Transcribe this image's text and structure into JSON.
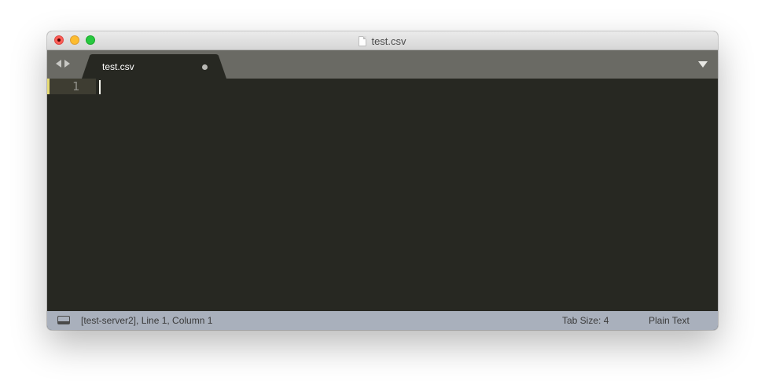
{
  "window": {
    "title": "test.csv"
  },
  "tabs": [
    {
      "label": "test.csv",
      "dirty": true
    }
  ],
  "editor": {
    "line_numbers": [
      "1"
    ]
  },
  "status_bar": {
    "location": "[test-server2], Line 1, Column 1",
    "tab_size": "Tab Size: 4",
    "syntax": "Plain Text"
  },
  "icons": {
    "file": "file-icon",
    "panel": "panel-toggle-icon"
  },
  "colors": {
    "editor_background": "#272822",
    "tabbar_background": "#6a6a64",
    "statusbar_background": "#a9b0bc",
    "close": "#fc5f57",
    "minimize": "#fdbc2e",
    "zoom": "#28c840",
    "gutter_mark": "#e6db74"
  }
}
